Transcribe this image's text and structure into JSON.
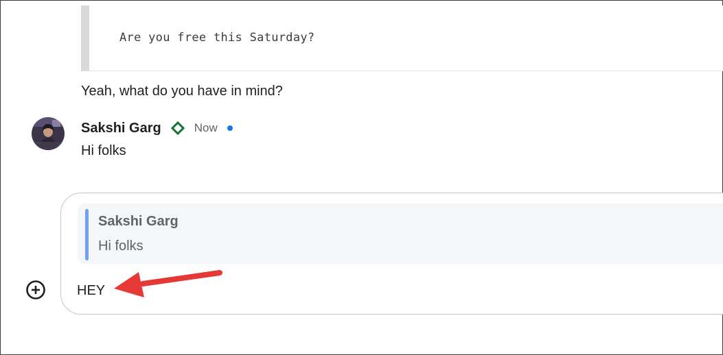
{
  "thread": {
    "quoted_message": "Are you free this Saturday?",
    "previous_message": "Yeah, what do you have in mind?"
  },
  "message": {
    "sender": "Sakshi Garg",
    "badge_icon": "diamond-outline-icon",
    "badge_color": "#137333",
    "timestamp": "Now",
    "unread_indicator_color": "#1a73e8",
    "body": "Hi folks"
  },
  "composer": {
    "reply_to": {
      "sender": "Sakshi Garg",
      "text": "Hi folks",
      "bar_color": "#6fa2f5"
    },
    "input_value": "HEY",
    "add_icon": "plus-circle-icon"
  },
  "annotation": {
    "arrow_color": "#e53935"
  }
}
